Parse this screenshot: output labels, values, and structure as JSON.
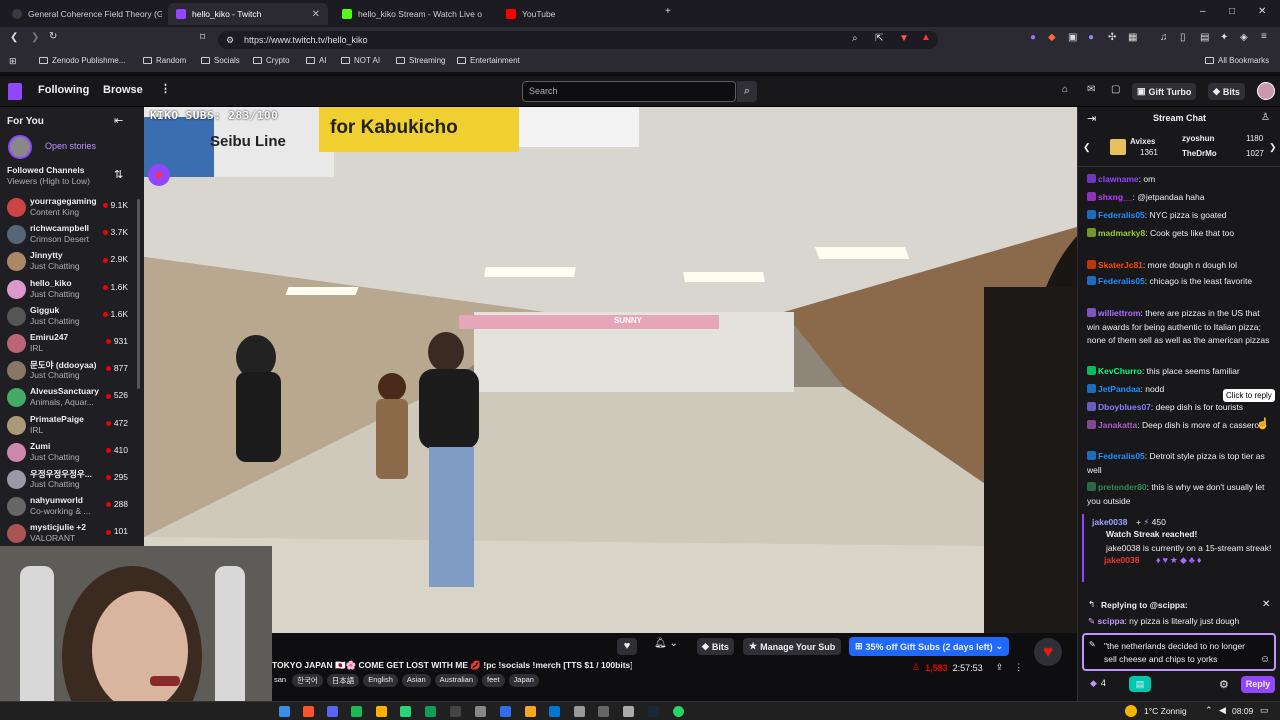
{
  "browser": {
    "tabs": [
      {
        "label": "General Coherence Field Theory (GC",
        "color": "#444"
      },
      {
        "label": "hello_kiko - Twitch",
        "color": "#9146ff"
      },
      {
        "label": "hello_kiko Stream - Watch Live o",
        "color": "#53fc18"
      },
      {
        "label": "YouTube",
        "color": "#ff0000"
      }
    ],
    "url": "https://www.twitch.tv/hello_kiko",
    "bookmarks": [
      "Zenodo Publishme...",
      "Random",
      "Socials",
      "Crypto",
      "AI",
      "NOT AI",
      "Streaming",
      "Entertainment"
    ],
    "all_bookmarks": "All Bookmarks"
  },
  "topnav": {
    "following": "Following",
    "browse": "Browse",
    "search_placeholder": "Search",
    "gift_turbo": "Gift Turbo",
    "bits": "Bits"
  },
  "sidebar": {
    "for_you": "For You",
    "open_stories": "Open stories",
    "followed_channels": "Followed Channels",
    "sort": "Viewers (High to Low)",
    "channels": [
      {
        "name": "yourragegaming",
        "category": "Content King",
        "viewers": "9.1K",
        "color": "#c44"
      },
      {
        "name": "richwcampbell",
        "category": "Crimson Desert",
        "viewers": "3.7K",
        "color": "#567"
      },
      {
        "name": "Jinnytty",
        "category": "Just Chatting",
        "viewers": "2.9K",
        "color": "#a86"
      },
      {
        "name": "hello_kiko",
        "category": "Just Chatting",
        "viewers": "1.6K",
        "color": "#d9c"
      },
      {
        "name": "Gigguk",
        "category": "Just Chatting",
        "viewers": "1.6K",
        "color": "#555"
      },
      {
        "name": "Emiru247",
        "category": "IRL",
        "viewers": "931",
        "color": "#b67"
      },
      {
        "name": "문도야 (ddooyaa)",
        "category": "Just Chatting",
        "viewers": "877",
        "color": "#876"
      },
      {
        "name": "AlveusSanctuary",
        "category": "Animals, Aquar...",
        "viewers": "526",
        "color": "#4a6"
      },
      {
        "name": "PrimatePaige",
        "category": "IRL",
        "viewers": "472",
        "color": "#a97"
      },
      {
        "name": "Zumi",
        "category": "Just Chatting",
        "viewers": "410",
        "color": "#c8a"
      },
      {
        "name": "우정우정우정우...",
        "category": "Just Chatting",
        "viewers": "295",
        "color": "#99a"
      },
      {
        "name": "nahyunworld",
        "category": "Co-working & ...",
        "viewers": "288",
        "color": "#666"
      },
      {
        "name": "mysticjulie +2",
        "category": "VALORANT",
        "viewers": "101",
        "color": "#a55"
      }
    ]
  },
  "video": {
    "overlay": "KIKO SUBS: 283/100",
    "sign_seibu": "Seibu Line",
    "sign_kabukicho": "for Kabukicho",
    "banner": "SUNNY"
  },
  "stream_info": {
    "title": "TOKYO JAPAN 🇯🇵🌸 COME GET LOST WITH ME 💋 !pc !socials !merch [TTS $1 / 100bits]",
    "tags": [
      "한국어",
      "日本語",
      "English",
      "Asian",
      "Australian",
      "feet",
      "Japan"
    ],
    "tag_prefix": "san",
    "bits": "Bits",
    "manage_sub": "Manage Your Sub",
    "gift_subs": "35% off Gift Subs (2 days left)",
    "viewers": "1,583",
    "uptime": "2:57:53"
  },
  "chat": {
    "header": "Stream Chat",
    "leaderboard": [
      {
        "name": "Avixes",
        "value": "1361"
      },
      {
        "name": "zyoshun",
        "value": "1180"
      },
      {
        "name": "TheDrMo",
        "value": "1027"
      }
    ],
    "messages": [
      {
        "user": "clawname",
        "color": "#9146ff",
        "text": "om"
      },
      {
        "user": "shxng__",
        "color": "#c03cff",
        "text": "@jetpandaa haha"
      },
      {
        "user": "Federalis05",
        "color": "#1e90ff",
        "text": "NYC pizza is goated"
      },
      {
        "user": "madmarky8",
        "color": "#9acd32",
        "text": "Cook gets like that too"
      },
      {
        "user": "SkaterJc81",
        "color": "#ff4500",
        "text": "more dough n dough lol"
      },
      {
        "user": "Federalis05",
        "color": "#1e90ff",
        "text": "chicago is the least favorite"
      },
      {
        "user": "williettrom",
        "color": "#a970ff",
        "text": "there are pizzas in the US that win awards for being authentic to Italian pizza; none of them sell as well as the american pizzas"
      },
      {
        "user": "KevChurro",
        "color": "#00ff7f",
        "text": "this place seems familiar"
      },
      {
        "user": "JetPandaa",
        "color": "#1e90ff",
        "text": "nodd"
      },
      {
        "user": "Dboyblues07",
        "color": "#8a7cff",
        "text": "deep dish is for tourists"
      },
      {
        "user": "Janakatta",
        "color": "#b05cc4",
        "text": "Deep dish is more of a casserole"
      },
      {
        "user": "Federalis05",
        "color": "#1e90ff",
        "text": "Detroit style pizza is top tier as well"
      },
      {
        "user": "pretender80",
        "color": "#2e8b57",
        "text": "this is why we don't usually let you outside"
      }
    ],
    "tooltip": "Click to reply",
    "watch_streak": {
      "user": "jake0038",
      "points": "450",
      "title": "Watch Streak reached!",
      "text": "jake0038 is currently on a 15-stream streak!",
      "emote_user": "jake0038"
    },
    "reply": {
      "header": "Replying to @scippa:",
      "user": "scippa",
      "text": "ny pizza is literally just dough"
    },
    "input_value": "\"the netherlands decided to no longer sell cheese and chips to yorks",
    "points": "4",
    "reply_button": "Reply"
  },
  "taskbar": {
    "weather": "1°C  Zonnig",
    "time": "08:09"
  }
}
